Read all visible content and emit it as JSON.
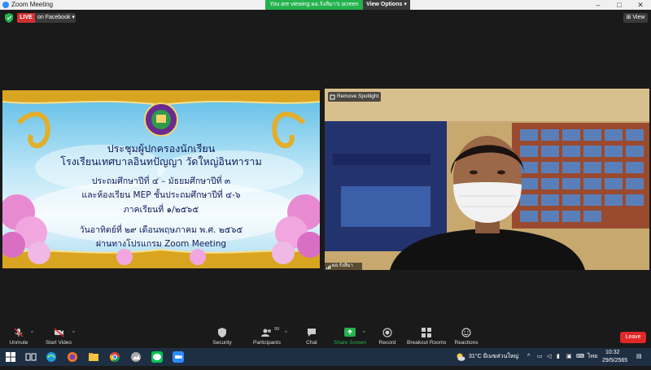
{
  "window": {
    "title": "Zoom Meeting",
    "minimize": "–",
    "maximize": "□",
    "close": "✕"
  },
  "banner": {
    "viewing_text": "You are viewing ผอ.รังสิมา's screen",
    "view_options": "View Options ▾"
  },
  "topbar": {
    "live_label": "LIVE",
    "live_target": "on Facebook ▾",
    "view_button": "⊞ View"
  },
  "slide": {
    "line1": "ประชุมผู้ปกครองนักเรียน",
    "line2": "โรงเรียนเทศบาลอินทปัญญา วัดใหญ่อินทาราม",
    "line3": "ประถมศึกษาปีที่ ๔ – มัธยมศึกษาปีที่ ๓",
    "line4": "และห้องเรียน MEP ชั้นประถมศึกษาปีที่ ๔-๖",
    "line5": "ภาคเรียนที่ ๑/๒๕๖๕",
    "line6": "วันอาทิตย์ที่ ๒๙ เดือนพฤษภาคม พ.ศ. ๒๕๖๕",
    "line7": "ผ่านทางโปรแกรม Zoom Meeting"
  },
  "speaker": {
    "remove_spotlight": "Remove Spotlight",
    "name": "ผอ.รังสิมา"
  },
  "toolbar": {
    "unmute": "Unmute",
    "start_video": "Start Video",
    "security": "Security",
    "participants": "Participants",
    "participants_count": "99",
    "chat": "Chat",
    "share_screen": "Share Screen",
    "record": "Record",
    "breakout_rooms": "Breakout Rooms",
    "reactions": "Reactions",
    "leave": "Leave"
  },
  "taskbar": {
    "weather": "31°C  มีเมฆส่วนใหญ่",
    "language": "ไทย",
    "time": "10:32",
    "date": "29/5/2565"
  },
  "colors": {
    "zoom_blue": "#2d8cff",
    "live_red": "#d32f2f",
    "share_green": "#24b24e",
    "leave_red": "#e02828",
    "taskbar": "#1f2f43"
  }
}
